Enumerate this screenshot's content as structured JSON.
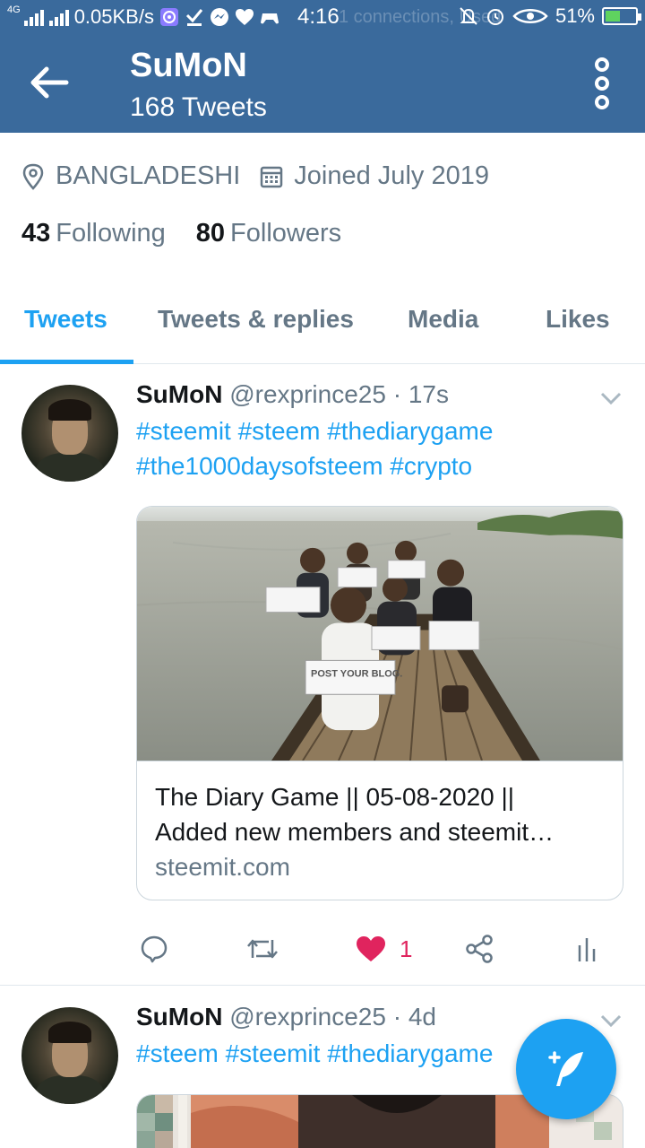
{
  "status_bar": {
    "network": "4G",
    "speed": "0.05KB/s",
    "time": "4:16",
    "ghost_text": "1 connections, Used",
    "battery": "51%",
    "battery_level": 0.51
  },
  "header": {
    "title": "SuMoN",
    "subtitle": "168 Tweets"
  },
  "profile": {
    "location": "BANGLADESHI",
    "joined": "Joined July 2019",
    "following_count": "43",
    "following_label": "Following",
    "followers_count": "80",
    "followers_label": "Followers"
  },
  "tabs": [
    {
      "label": "Tweets",
      "active": true
    },
    {
      "label": "Tweets & replies",
      "active": false
    },
    {
      "label": "Media",
      "active": false
    },
    {
      "label": "Likes",
      "active": false
    }
  ],
  "tweets": [
    {
      "name": "SuMoN",
      "handle": "@rexprince25",
      "time": "· 17s",
      "text_line1": "#steemit #steem #thediarygame",
      "text_line2": "#the1000daysofsteem #crypto",
      "card": {
        "title_line1": "The Diary Game || 05-08-2020 ||",
        "title_line2": "Added new members and steemit…",
        "domain": "steemit.com",
        "sign_text": "POST YOUR BLOG."
      },
      "likes": "1"
    },
    {
      "name": "SuMoN",
      "handle": "@rexprince25",
      "time": "· 4d",
      "text_line1": "#steem #steemit #thediarygame"
    }
  ],
  "colors": {
    "header_bg": "#3a6a9c",
    "accent": "#1da1f2",
    "like": "#e0245e",
    "muted": "#657786"
  }
}
